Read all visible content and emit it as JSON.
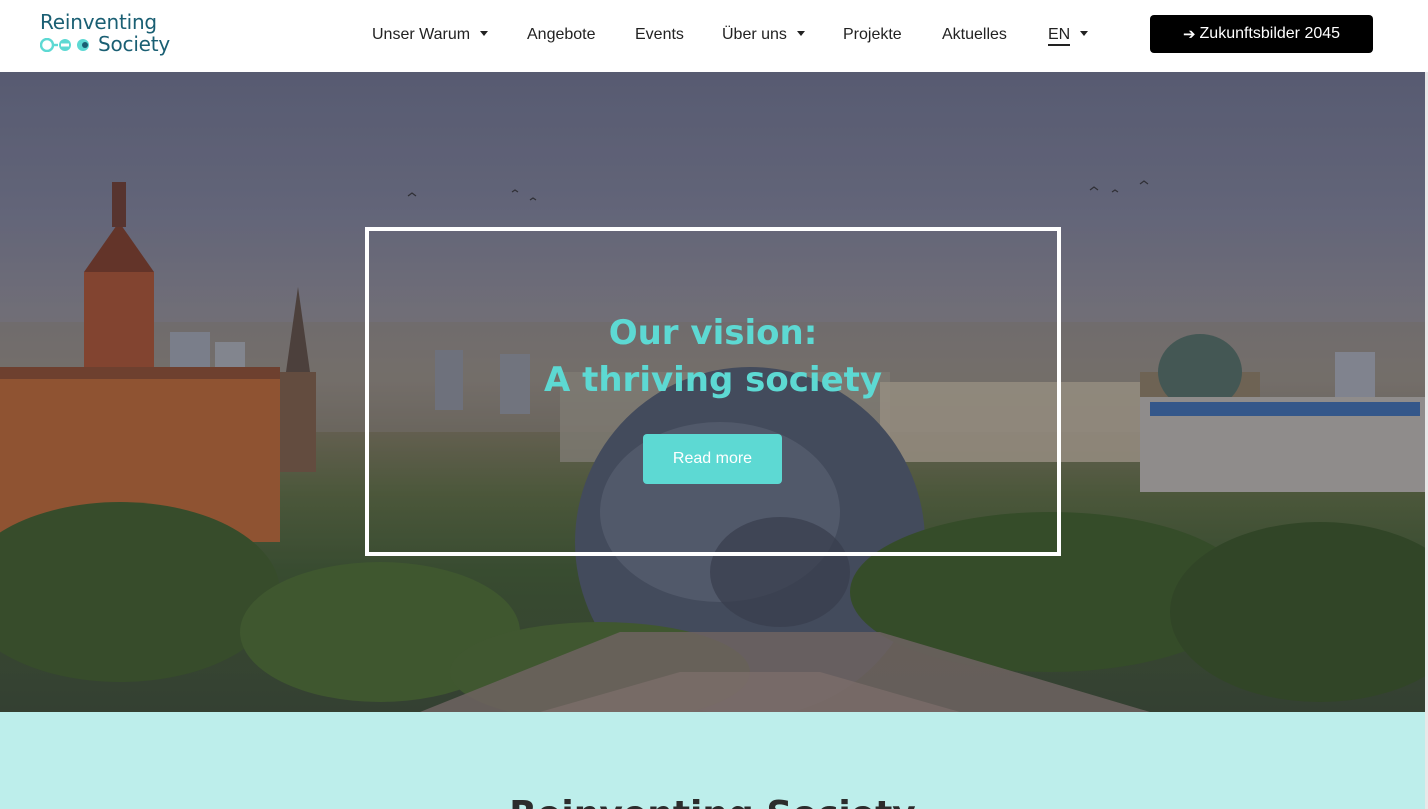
{
  "header": {
    "logo": {
      "line1": "Reinventing",
      "line2": "Society"
    },
    "nav": [
      {
        "label": "Unser Warum",
        "has_dropdown": true
      },
      {
        "label": "Angebote",
        "has_dropdown": false
      },
      {
        "label": "Events",
        "has_dropdown": false
      },
      {
        "label": "Über uns",
        "has_dropdown": true
      },
      {
        "label": "Projekte",
        "has_dropdown": false
      },
      {
        "label": "Aktuelles",
        "has_dropdown": false
      }
    ],
    "language": {
      "label": "EN",
      "has_dropdown": true
    },
    "cta": {
      "arrow": "➔",
      "label": "Zukunftsbilder 2045"
    }
  },
  "hero": {
    "title_line1": "Our vision:",
    "title_line2": "A thriving society",
    "button_label": "Read more"
  },
  "section": {
    "heading": "Reinventing Society"
  },
  "colors": {
    "accent": "#5dd9d3",
    "brand_text": "#1a5f73",
    "section_bg": "#bdeeeb",
    "cta_bg": "#000000"
  },
  "icons": {
    "logo_mark": "three-linked-circles-icon",
    "dropdown": "caret-down-icon",
    "cta_arrow": "arrow-right-icon"
  }
}
